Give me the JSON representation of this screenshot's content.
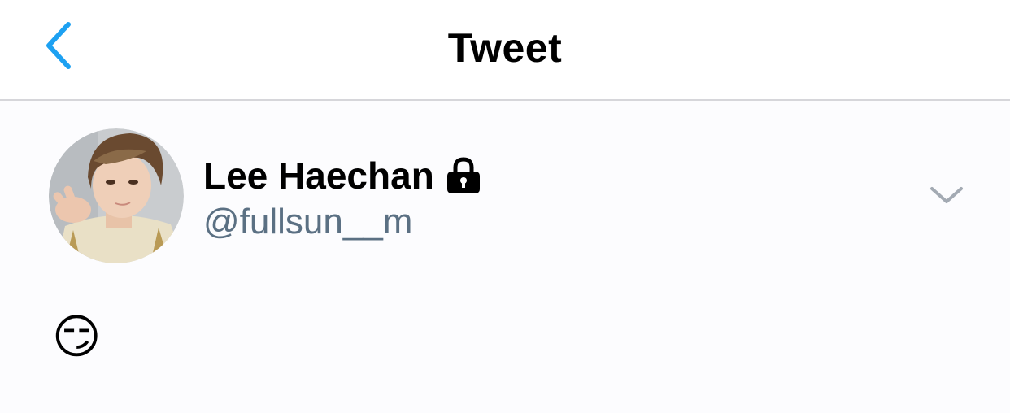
{
  "nav": {
    "title": "Tweet",
    "back_icon": "chevron-left-icon",
    "accent_color": "#1da1f2"
  },
  "tweet": {
    "author": {
      "name": "Lee Haechan",
      "handle": "@fullsun__m",
      "protected": true,
      "avatar": "profile-photo"
    },
    "text": "😏",
    "more_icon": "chevron-down-icon"
  },
  "colors": {
    "background": "#fcfcfe",
    "nav_background": "#ffffff",
    "divider": "#d6d6da",
    "handle": "#5b7083",
    "chevron": "#a3aab3"
  }
}
